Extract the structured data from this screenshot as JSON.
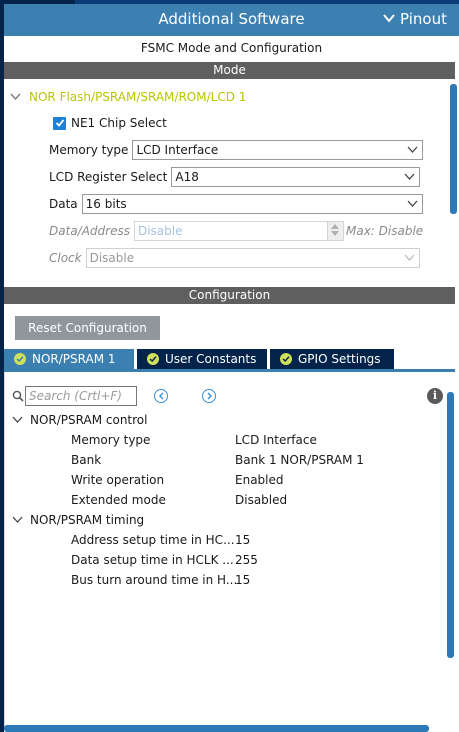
{
  "header": {
    "title": "Additional Software",
    "pinout_label": "Pinout"
  },
  "panel_title": "FSMC Mode and Configuration",
  "mode_section": {
    "header": "Mode",
    "nor_title": "NOR Flash/PSRAM/SRAM/ROM/LCD 1",
    "chip_select_label": "NE1 Chip Select",
    "chip_select_checked": true,
    "fields": {
      "memory_type": {
        "label": "Memory type",
        "value": "LCD Interface"
      },
      "lcd_register_select": {
        "label": "LCD Register Select",
        "value": "A18"
      },
      "data": {
        "label": "Data",
        "value": "16 bits"
      },
      "data_address": {
        "label": "Data/Address",
        "value": "Disable",
        "max_label": "Max: Disable"
      },
      "clock": {
        "label": "Clock",
        "value": "Disable"
      }
    }
  },
  "config_section": {
    "header": "Configuration",
    "reset_button": "Reset Configuration",
    "tabs": [
      {
        "label": "NOR/PSRAM 1",
        "active": true
      },
      {
        "label": "User Constants",
        "active": false
      },
      {
        "label": "GPIO Settings",
        "active": false
      }
    ],
    "search_placeholder": "Search (Crtl+F)",
    "groups": [
      {
        "title": "NOR/PSRAM control",
        "params": [
          {
            "name": "Memory type",
            "value": "LCD Interface"
          },
          {
            "name": "Bank",
            "value": "Bank 1 NOR/PSRAM 1"
          },
          {
            "name": "Write operation",
            "value": "Enabled"
          },
          {
            "name": "Extended mode",
            "value": "Disabled"
          }
        ]
      },
      {
        "title": "NOR/PSRAM timing",
        "params": [
          {
            "name": "Address setup time in HC...",
            "value": "15"
          },
          {
            "name": "Data setup time in HCLK ...",
            "value": "255"
          },
          {
            "name": "Bus turn around time in H...",
            "value": "15"
          }
        ]
      }
    ]
  },
  "colors": {
    "accent_blue": "#3c7fb1",
    "dark_navy": "#03234b",
    "section_gray": "#5f5f5f",
    "title_lime": "#b8c600",
    "check_blue": "#1d82d6"
  },
  "icons": {
    "pinout": "chevron-down-icon",
    "tree_toggle": "chevron-down-icon",
    "tab_status": "check-circle-icon",
    "search": "search-icon",
    "prev": "chevron-left-icon",
    "next": "chevron-right-icon",
    "info": "info-icon"
  }
}
